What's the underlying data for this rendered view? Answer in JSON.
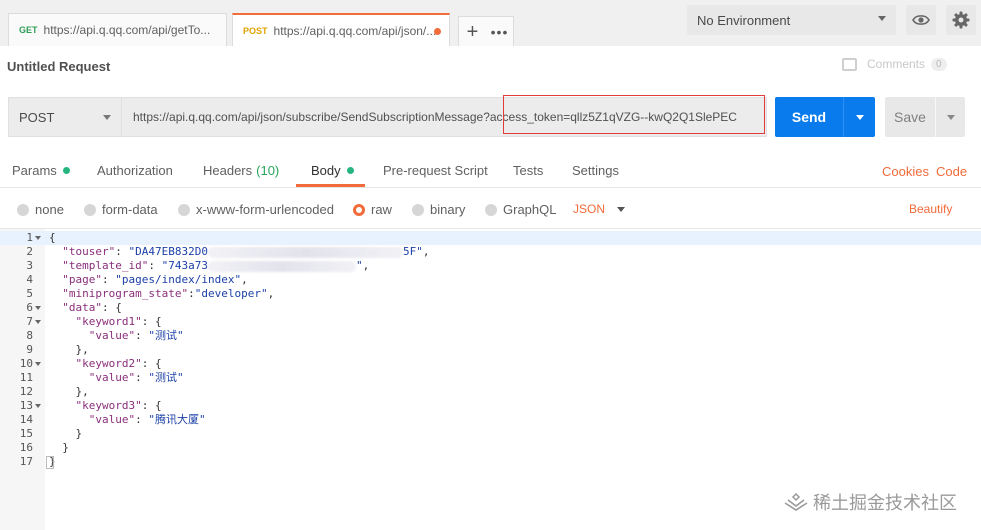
{
  "tabs": [
    {
      "method": "GET",
      "label": "https://api.q.qq.com/api/getTo..."
    },
    {
      "method": "POST",
      "label": "https://api.q.qq.com/api/json/..."
    }
  ],
  "tab_controls": {
    "add": "+",
    "more": "•••"
  },
  "environment": {
    "selected": "No Environment"
  },
  "request": {
    "title": "Untitled Request",
    "comments_label": "Comments",
    "comments_count": "0",
    "method": "POST",
    "url": "https://api.q.qq.com/api/json/subscribe/SendSubscriptionMessage?access_token=qllz5Z1qVZG--kwQ2Q1SlePEC",
    "send_label": "Send",
    "save_label": "Save"
  },
  "subtabs": {
    "params": "Params",
    "authorization": "Authorization",
    "headers": "Headers",
    "headers_count": "(10)",
    "body": "Body",
    "prerequest": "Pre-request Script",
    "tests": "Tests",
    "settings": "Settings",
    "cookies": "Cookies",
    "code": "Code"
  },
  "body_types": {
    "none": "none",
    "form_data": "form-data",
    "urlencoded": "x-www-form-urlencoded",
    "raw": "raw",
    "binary": "binary",
    "graphql": "GraphQL",
    "format": "JSON",
    "beautify": "Beautify"
  },
  "editor": {
    "line_numbers": [
      "1",
      "2",
      "3",
      "4",
      "5",
      "6",
      "7",
      "8",
      "9",
      "10",
      "11",
      "12",
      "13",
      "14",
      "15",
      "16",
      "17"
    ],
    "touser_prefix": "\"DA47EB832D0",
    "touser_suffix": "5F\"",
    "template_prefix": "\"743a73",
    "template_suffix": "\"",
    "page_value": "\"pages/index/index\"",
    "state_value": "\"developer\"",
    "value_1": "\"测试\"",
    "value_2": "\"测试\"",
    "value_3": "\"腾讯大厦\""
  },
  "watermark": "稀土掘金技术社区"
}
